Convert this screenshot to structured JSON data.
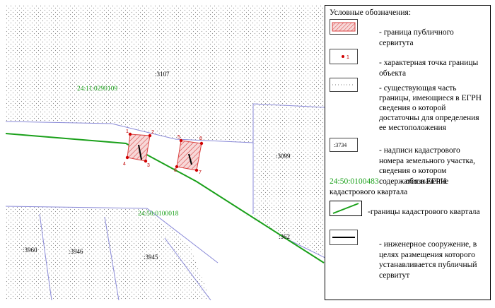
{
  "map": {
    "labels": {
      "parcel_3107": ":3107",
      "quarter_top": "24:11:0290109",
      "quarter_bottom": "24:50:0100018",
      "parcel_3099": ":3099",
      "parcel_362": ":362",
      "parcel_3960": ":3960",
      "parcel_3946": ":3946",
      "parcel_3945": ":3945"
    },
    "points": [
      "1",
      "2",
      "3",
      "4",
      "5",
      "6",
      "7",
      "8"
    ],
    "colors": {
      "quarter_boundary": "#1aa01a",
      "parcel_boundary": "#8a8ad8",
      "servitude_hatch": "#d94040",
      "point": "#d00000",
      "structure": "#000000",
      "quarter_label": "#1aa01a"
    }
  },
  "legend": {
    "title": "Условные обозначения:",
    "items": [
      {
        "label": "- граница публичного сервитута"
      },
      {
        "symbol_text": "1",
        "label": "- характерная точка границы объекта"
      },
      {
        "label": "- существующая часть границы, имеющиеся в ЕГРН сведения о которой достаточны для определения ее местоположения"
      },
      {
        "symbol_text": ":3734",
        "label": "- надписи кадастрового номера земельного участка, сведения о котором содержатся в ЕГРН"
      },
      {
        "code": "24:50:0100483",
        "label": "- обозначение кадастрового квартала"
      },
      {
        "label": "-границы кадастрового квартала"
      },
      {
        "label": "- инженерное сооружение, в целях размещения которого устанавливается публичный сервитут"
      }
    ]
  }
}
